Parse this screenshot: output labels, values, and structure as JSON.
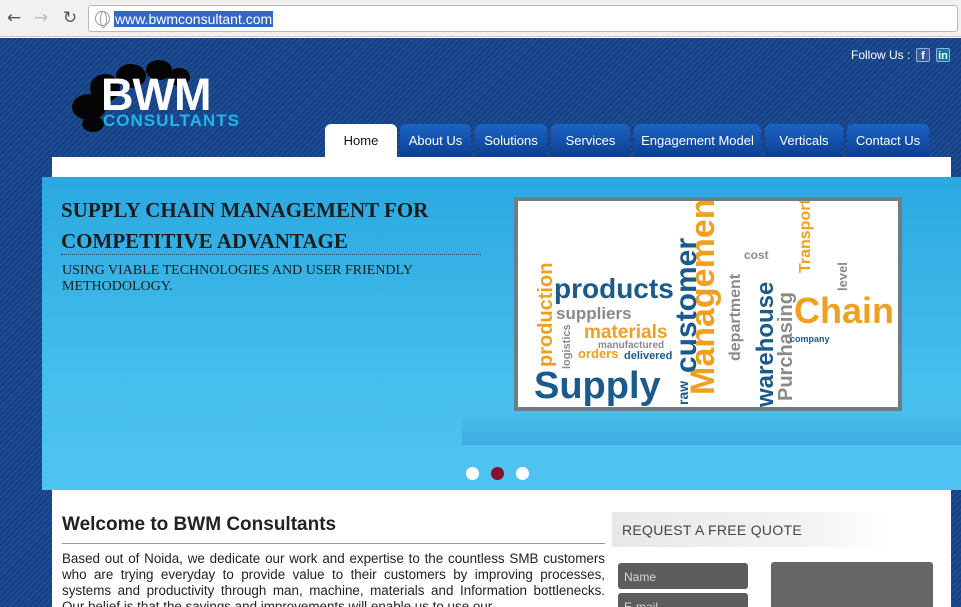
{
  "browser": {
    "url": "www.bwmconsultant.com",
    "back_icon": "arrow-left-icon",
    "forward_icon": "arrow-right-icon",
    "reload_icon": "reload-icon"
  },
  "header": {
    "follow_label": "Follow Us :",
    "social": [
      {
        "name": "facebook-icon",
        "glyph": "f"
      },
      {
        "name": "linkedin-icon",
        "glyph": "in"
      }
    ],
    "logo": {
      "word": "BWM",
      "sub": "CONSULTANTS"
    }
  },
  "nav": {
    "items": [
      {
        "label": "Home",
        "active": true
      },
      {
        "label": "About Us"
      },
      {
        "label": "Solutions"
      },
      {
        "label": "Services"
      },
      {
        "label": "Engagement Model"
      },
      {
        "label": "Verticals"
      },
      {
        "label": "Contact Us"
      }
    ]
  },
  "banner": {
    "headline_line1": "SUPPLY CHAIN MANAGEMENT FOR",
    "headline_line2": "COMPETITIVE ADVANTAGE",
    "subline": "USING VIABLE TECHNOLOGIES AND USER FRIENDLY METHODOLOGY.",
    "slides_total": 3,
    "active_slide": 2,
    "word_cloud": [
      "Supply",
      "Chain",
      "Management",
      "customer",
      "products",
      "materials",
      "warehouse",
      "Purchasing",
      "production",
      "suppliers",
      "department",
      "Transport",
      "orders",
      "delivered",
      "company",
      "raw",
      "logistics",
      "manufactured",
      "level",
      "cost"
    ],
    "colors": {
      "orange": "#f0a020",
      "blue": "#1a5a8c",
      "gray": "#8a8a8a"
    }
  },
  "welcome": {
    "title": "Welcome to BWM Consultants",
    "body": "Based out of Noida, we dedicate our work and expertise to the countless SMB customers who are trying everyday to provide value to their customers by improving processes, systems and productivity through man, machine, materials and Information bottlenecks. Our belief is that the savings and improvements will enable us to use our"
  },
  "quote": {
    "title": "REQUEST A FREE QUOTE",
    "name_placeholder": "Name",
    "email_placeholder": "E-mail"
  }
}
